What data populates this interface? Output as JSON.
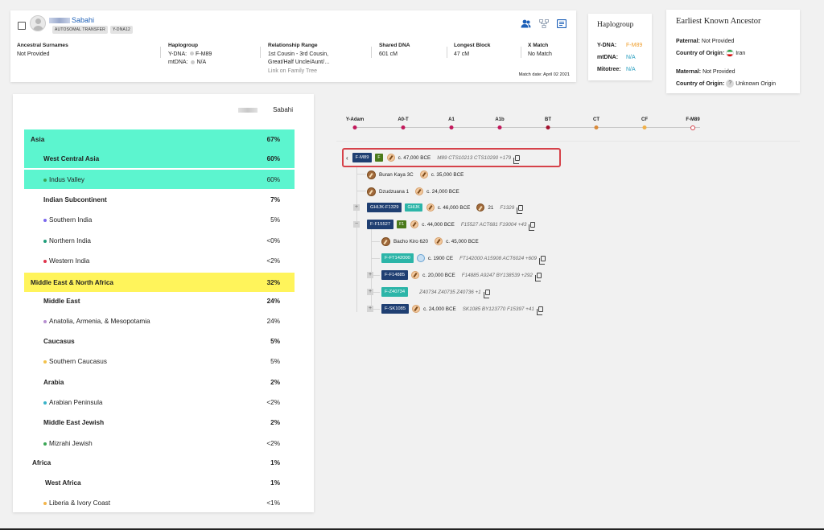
{
  "match": {
    "name": "Sabahi",
    "badges": [
      "AUTOSOMAL TRANSFER",
      "Y-DNA12"
    ],
    "columns": {
      "surnames": {
        "label": "Ancestral Surnames",
        "value": "Not Provided"
      },
      "haplogroup": {
        "label": "Haplogroup",
        "ydna_label": "Y-DNA:",
        "ydna_value": "F-M89",
        "mtdna_label": "mtDNA:",
        "mtdna_value": "N/A"
      },
      "relationship": {
        "label": "Relationship Range",
        "line1": "1st Cousin - 3rd Cousin,",
        "line2": "Great/Half Uncle/Aunt/…",
        "link": "Link on Family Tree"
      },
      "shared": {
        "label": "Shared DNA",
        "value": "601 cM"
      },
      "longest": {
        "label": "Longest Block",
        "value": "47 cM"
      },
      "xmatch": {
        "label": "X Match",
        "value": "No Match"
      }
    },
    "match_date": "Match date: April 02 2021",
    "icons": [
      "people-icon",
      "tree-structure-icon",
      "notes-icon"
    ]
  },
  "haplogroup_card": {
    "title": "Haplogroup",
    "rows": [
      {
        "label": "Y-DNA:",
        "value": "F-M89",
        "color": "#f0a030"
      },
      {
        "label": "mtDNA:",
        "value": "N/A",
        "color": "#2a9fc0"
      },
      {
        "label": "Mitotree:",
        "value": "N/A",
        "color": "#2a9fc0"
      }
    ]
  },
  "ancestor_card": {
    "title": "Earliest Known Ancestor",
    "paternal_label": "Paternal:",
    "paternal_value": "Not Provided",
    "country_label": "Country of Origin:",
    "paternal_country": "Iran",
    "maternal_label": "Maternal:",
    "maternal_value": "Not Provided",
    "maternal_country": "Unknown Origin"
  },
  "ethnicity": {
    "header_name": "Sabahi",
    "rows": [
      {
        "name": "Asia",
        "pct": "67%",
        "level": 0,
        "bold": true
      },
      {
        "name": "West Central Asia",
        "pct": "60%",
        "level": 1,
        "bold": true
      },
      {
        "name": "Indus Valley",
        "pct": "60%",
        "level": 2,
        "bold": false,
        "dot": "#3aa655"
      },
      {
        "name": "Indian Subcontinent",
        "pct": "7%",
        "level": 1,
        "bold": true
      },
      {
        "name": "Southern India",
        "pct": "5%",
        "level": 2,
        "bold": false,
        "dot": "#7b68ee"
      },
      {
        "name": "Northern India",
        "pct": "<0%",
        "level": 2,
        "bold": false,
        "dot": "#1f9e7a"
      },
      {
        "name": "Western India",
        "pct": "<2%",
        "level": 2,
        "bold": false,
        "dot": "#e0344c"
      },
      {
        "name": "Middle East & North Africa",
        "pct": "32%",
        "level": 0,
        "bold": true
      },
      {
        "name": "Middle East",
        "pct": "24%",
        "level": 1,
        "bold": true
      },
      {
        "name": "Anatolia, Armenia, & Mesopotamia",
        "pct": "24%",
        "level": 2,
        "bold": false,
        "dot": "#b78fd0"
      },
      {
        "name": "Caucasus",
        "pct": "5%",
        "level": 1,
        "bold": true
      },
      {
        "name": "Southern Caucasus",
        "pct": "5%",
        "level": 2,
        "bold": false,
        "dot": "#f3c24b"
      },
      {
        "name": "Arabia",
        "pct": "2%",
        "level": 1,
        "bold": true
      },
      {
        "name": "Arabian Peninsula",
        "pct": "<2%",
        "level": 2,
        "bold": false,
        "dot": "#38b3c8"
      },
      {
        "name": "Middle East Jewish",
        "pct": "2%",
        "level": 1,
        "bold": true
      },
      {
        "name": "Mizrahi Jewish",
        "pct": "<2%",
        "level": 2,
        "bold": false,
        "dot": "#3aa655"
      },
      {
        "name": "Africa",
        "pct": "1%",
        "level": 0,
        "bold": true
      },
      {
        "name": "West Africa",
        "pct": "1%",
        "level": 1,
        "bold": true
      },
      {
        "name": "Liberia & Ivory Coast",
        "pct": "<1%",
        "level": 2,
        "bold": false,
        "dot": "#f3b54a"
      }
    ]
  },
  "timeline": [
    {
      "label": "Y-Adam",
      "color": "#c2185b"
    },
    {
      "label": "A0-T",
      "color": "#c2185b"
    },
    {
      "label": "A1",
      "color": "#c2185b"
    },
    {
      "label": "A1b",
      "color": "#c2185b"
    },
    {
      "label": "BT",
      "color": "#a3112d"
    },
    {
      "label": "CT",
      "color": "#d98a3a"
    },
    {
      "label": "CF",
      "color": "#f0b04a"
    },
    {
      "label": "F-M89",
      "color": "#d6424a",
      "hollow": true
    }
  ],
  "tree": {
    "selected": {
      "hg": "F-M89",
      "tag": "F",
      "date": "c. 47,000 BCE",
      "snps": "M89  CTS10213  CTS10290  +179"
    },
    "nodes": [
      {
        "kind": "ancient",
        "name": "Buran Kaya 3C",
        "date": "c. 35,000 BCE"
      },
      {
        "kind": "ancient",
        "name": "Dzudzuana 1",
        "date": "c. 24,000 BCE"
      },
      {
        "kind": "hg",
        "hg": "GHIJK-F1329",
        "tag": "GHIJK",
        "date": "c. 46,000 BCE",
        "count": "21",
        "snps": "F1329"
      },
      {
        "kind": "hg",
        "hg": "F-F15527",
        "tag": "F1",
        "date": "c. 44,000 BCE",
        "snps": "F15527  ACT681  F19004  +43"
      },
      {
        "kind": "ancient",
        "name": "Bacho Kiro 620",
        "date": "c. 45,000 BCE"
      },
      {
        "kind": "hg",
        "hg": "F-FT142000",
        "date": "c. 1900 CE",
        "snps": "FT142000  A15908  ACT6024  +609"
      },
      {
        "kind": "hg",
        "hg": "F-F14885",
        "date": "c. 20,000 BCE",
        "snps": "F14885  A9247  BY138539  +292"
      },
      {
        "kind": "hg",
        "hg": "F-Z40734",
        "snps": "Z40734  Z40735  Z40736  +1"
      },
      {
        "kind": "hg",
        "hg": "F-SK1085",
        "date": "c. 24,000 BCE",
        "snps": "SK1085  BY123770  F15397  +41"
      }
    ]
  }
}
